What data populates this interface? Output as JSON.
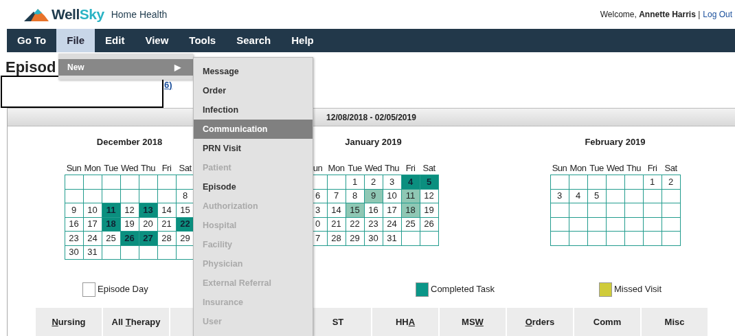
{
  "header": {
    "logo": {
      "dark_part": "Well",
      "accent_part": "Sky"
    },
    "product": "Home Health",
    "welcome": "Welcome, **Annette Harris** |",
    "logout": "Log Out"
  },
  "menu_bar": [
    {
      "label": "Go To",
      "selected": false
    },
    {
      "label": "File",
      "selected": true
    },
    {
      "label": "Edit",
      "selected": false
    },
    {
      "label": "View",
      "selected": false
    },
    {
      "label": "Tools",
      "selected": false
    },
    {
      "label": "Search",
      "selected": false
    },
    {
      "label": "Help",
      "selected": false
    }
  ],
  "file_menu": [
    {
      "label": "New",
      "arrow": "▶",
      "selected": true
    }
  ],
  "new_submenu": [
    {
      "label": "Message",
      "selected": false,
      "disabled": false
    },
    {
      "label": "Order",
      "selected": false,
      "disabled": false
    },
    {
      "label": "Infection",
      "selected": false,
      "disabled": false
    },
    {
      "label": "Communication",
      "selected": true,
      "disabled": false
    },
    {
      "label": "PRN Visit",
      "selected": false,
      "disabled": false
    },
    {
      "label": "Patient",
      "selected": false,
      "disabled": true
    },
    {
      "label": "Episode",
      "selected": false,
      "disabled": false
    },
    {
      "label": "Authorization",
      "selected": false,
      "disabled": true
    },
    {
      "label": "Hospital",
      "selected": false,
      "disabled": true
    },
    {
      "label": "Facility",
      "selected": false,
      "disabled": true
    },
    {
      "label": "Physician",
      "selected": false,
      "disabled": true
    },
    {
      "label": "External Referral",
      "selected": false,
      "disabled": true
    },
    {
      "label": "Insurance",
      "selected": false,
      "disabled": true
    },
    {
      "label": "User",
      "selected": false,
      "disabled": true
    }
  ],
  "page_title": "Episod",
  "link_fragment": "6)",
  "panel": {
    "date_range": "12/08/2018 - 02/05/2019",
    "calendars": [
      {
        "title": "December 2018",
        "weekdays": [
          "Sun",
          "Mon",
          "Tue",
          "Wed",
          "Thu",
          "Fri",
          "Sat"
        ],
        "weeks": [
          [
            {
              "kind": "blank"
            },
            {
              "kind": "blank"
            },
            {
              "kind": "blank"
            },
            {
              "kind": "blank"
            },
            {
              "kind": "blank"
            },
            {
              "kind": "blank"
            },
            {
              "kind": "blank"
            }
          ],
          [
            {
              "kind": "blank"
            },
            {
              "kind": "blank"
            },
            {
              "kind": "blank"
            },
            {
              "kind": "blank"
            },
            {
              "kind": "blank"
            },
            {
              "kind": "blank"
            },
            {
              "kind": "day",
              "day": "8",
              "completed": false,
              "highlighted": false
            }
          ],
          [
            {
              "kind": "day",
              "day": "9",
              "completed": false,
              "highlighted": false
            },
            {
              "kind": "day",
              "day": "10",
              "completed": false,
              "highlighted": false
            },
            {
              "kind": "day",
              "day": "11",
              "completed": true,
              "highlighted": false
            },
            {
              "kind": "day",
              "day": "12",
              "completed": false,
              "highlighted": false
            },
            {
              "kind": "day",
              "day": "13",
              "completed": true,
              "highlighted": false
            },
            {
              "kind": "day",
              "day": "14",
              "completed": false,
              "highlighted": false
            },
            {
              "kind": "day",
              "day": "15",
              "completed": false,
              "highlighted": false
            }
          ],
          [
            {
              "kind": "day",
              "day": "16",
              "completed": false,
              "highlighted": false
            },
            {
              "kind": "day",
              "day": "17",
              "completed": false,
              "highlighted": false
            },
            {
              "kind": "day",
              "day": "18",
              "completed": true,
              "highlighted": false
            },
            {
              "kind": "day",
              "day": "19",
              "completed": false,
              "highlighted": false
            },
            {
              "kind": "day",
              "day": "20",
              "completed": false,
              "highlighted": false
            },
            {
              "kind": "day",
              "day": "21",
              "completed": false,
              "highlighted": false
            },
            {
              "kind": "day",
              "day": "22",
              "completed": true,
              "highlighted": false
            }
          ],
          [
            {
              "kind": "day",
              "day": "23",
              "completed": false,
              "highlighted": false
            },
            {
              "kind": "day",
              "day": "24",
              "completed": false,
              "highlighted": false
            },
            {
              "kind": "day",
              "day": "25",
              "completed": false,
              "highlighted": false
            },
            {
              "kind": "day",
              "day": "26",
              "completed": true,
              "highlighted": false
            },
            {
              "kind": "day",
              "day": "27",
              "completed": true,
              "highlighted": false
            },
            {
              "kind": "day",
              "day": "28",
              "completed": false,
              "highlighted": false
            },
            {
              "kind": "day",
              "day": "29",
              "completed": false,
              "highlighted": false
            }
          ],
          [
            {
              "kind": "day",
              "day": "30",
              "completed": false,
              "highlighted": false
            },
            {
              "kind": "day",
              "day": "31",
              "completed": false,
              "highlighted": false
            },
            {
              "kind": "blank"
            },
            {
              "kind": "blank"
            },
            {
              "kind": "blank"
            },
            {
              "kind": "blank"
            },
            {
              "kind": "blank"
            }
          ]
        ]
      },
      {
        "title": "January 2019",
        "weekdays": [
          "un",
          "Mon",
          "Tue",
          "Wed",
          "Thu",
          "Fri",
          "Sat"
        ],
        "weeks": [
          [
            {
              "kind": "blank"
            },
            {
              "kind": "blank"
            },
            {
              "kind": "day",
              "day": "1",
              "completed": false,
              "highlighted": false
            },
            {
              "kind": "day",
              "day": "2",
              "completed": false,
              "highlighted": false
            },
            {
              "kind": "day",
              "day": "3",
              "completed": false,
              "highlighted": false
            },
            {
              "kind": "day",
              "day": "4",
              "completed": true,
              "highlighted": false
            },
            {
              "kind": "day",
              "day": "5",
              "completed": true,
              "highlighted": false
            }
          ],
          [
            {
              "kind": "day",
              "day": "6",
              "completed": false,
              "highlighted": false
            },
            {
              "kind": "day",
              "day": "7",
              "completed": false,
              "highlighted": false
            },
            {
              "kind": "day",
              "day": "8",
              "completed": false,
              "highlighted": false
            },
            {
              "kind": "day",
              "day": "9",
              "completed": false,
              "highlighted": true
            },
            {
              "kind": "day",
              "day": "10",
              "completed": false,
              "highlighted": false
            },
            {
              "kind": "day",
              "day": "11",
              "completed": false,
              "highlighted": true
            },
            {
              "kind": "day",
              "day": "12",
              "completed": false,
              "highlighted": false
            }
          ],
          [
            {
              "kind": "day",
              "day": "3",
              "completed": false,
              "highlighted": false
            },
            {
              "kind": "day",
              "day": "14",
              "completed": false,
              "highlighted": false
            },
            {
              "kind": "day",
              "day": "15",
              "completed": false,
              "highlighted": true
            },
            {
              "kind": "day",
              "day": "16",
              "completed": false,
              "highlighted": false
            },
            {
              "kind": "day",
              "day": "17",
              "completed": false,
              "highlighted": false
            },
            {
              "kind": "day",
              "day": "18",
              "completed": false,
              "highlighted": true
            },
            {
              "kind": "day",
              "day": "19",
              "completed": false,
              "highlighted": false
            }
          ],
          [
            {
              "kind": "day",
              "day": "0",
              "completed": false,
              "highlighted": false
            },
            {
              "kind": "day",
              "day": "21",
              "completed": false,
              "highlighted": false
            },
            {
              "kind": "day",
              "day": "22",
              "completed": false,
              "highlighted": false
            },
            {
              "kind": "day",
              "day": "23",
              "completed": false,
              "highlighted": false
            },
            {
              "kind": "day",
              "day": "24",
              "completed": false,
              "highlighted": false
            },
            {
              "kind": "day",
              "day": "25",
              "completed": false,
              "highlighted": false
            },
            {
              "kind": "day",
              "day": "26",
              "completed": false,
              "highlighted": false
            }
          ],
          [
            {
              "kind": "day",
              "day": "7",
              "completed": false,
              "highlighted": false
            },
            {
              "kind": "day",
              "day": "28",
              "completed": false,
              "highlighted": false
            },
            {
              "kind": "day",
              "day": "29",
              "completed": false,
              "highlighted": false
            },
            {
              "kind": "day",
              "day": "30",
              "completed": false,
              "highlighted": false
            },
            {
              "kind": "day",
              "day": "31",
              "completed": false,
              "highlighted": false
            },
            {
              "kind": "blank"
            },
            {
              "kind": "blank"
            }
          ]
        ]
      },
      {
        "title": "February 2019",
        "weekdays": [
          "Sun",
          "Mon",
          "Tue",
          "Wed",
          "Thu",
          "Fri",
          "Sat"
        ],
        "weeks": [
          [
            {
              "kind": "blank"
            },
            {
              "kind": "blank"
            },
            {
              "kind": "blank"
            },
            {
              "kind": "blank"
            },
            {
              "kind": "blank"
            },
            {
              "kind": "day",
              "day": "1",
              "completed": false,
              "highlighted": false
            },
            {
              "kind": "day",
              "day": "2",
              "completed": false,
              "highlighted": false
            }
          ],
          [
            {
              "kind": "day",
              "day": "3",
              "completed": false,
              "highlighted": false
            },
            {
              "kind": "day",
              "day": "4",
              "completed": false,
              "highlighted": false
            },
            {
              "kind": "day",
              "day": "5",
              "completed": false,
              "highlighted": false
            },
            {
              "kind": "blank"
            },
            {
              "kind": "blank"
            },
            {
              "kind": "blank"
            },
            {
              "kind": "blank"
            }
          ],
          [
            {
              "kind": "blank"
            },
            {
              "kind": "blank"
            },
            {
              "kind": "blank"
            },
            {
              "kind": "blank"
            },
            {
              "kind": "blank"
            },
            {
              "kind": "blank"
            },
            {
              "kind": "blank"
            }
          ],
          [
            {
              "kind": "blank"
            },
            {
              "kind": "blank"
            },
            {
              "kind": "blank"
            },
            {
              "kind": "blank"
            },
            {
              "kind": "blank"
            },
            {
              "kind": "blank"
            },
            {
              "kind": "blank"
            }
          ],
          [
            {
              "kind": "blank"
            },
            {
              "kind": "blank"
            },
            {
              "kind": "blank"
            },
            {
              "kind": "blank"
            },
            {
              "kind": "blank"
            },
            {
              "kind": "blank"
            },
            {
              "kind": "blank"
            }
          ]
        ]
      }
    ],
    "legend": [
      {
        "label": "Episode Day",
        "color": "#ffffff"
      },
      {
        "label": "Completed Task",
        "color": "#0b9688"
      },
      {
        "label": "Missed Visit",
        "color": "#cfcb3a"
      }
    ],
    "tabs": [
      {
        "kind": "label",
        "parts": [
          {
            "text": "N",
            "underlined": true
          },
          {
            "text": "ursing",
            "underlined": false
          }
        ]
      },
      {
        "kind": "label",
        "parts": [
          {
            "text": "All ",
            "underlined": false
          },
          {
            "text": "T",
            "underlined": true
          },
          {
            "text": "herapy",
            "underlined": false
          }
        ]
      },
      {
        "kind": "covered"
      },
      {
        "kind": "label",
        "parts": [
          {
            "text": "ST",
            "underlined": false
          }
        ]
      },
      {
        "kind": "label",
        "parts": [
          {
            "text": "HH",
            "underlined": false
          },
          {
            "text": "A",
            "underlined": true
          }
        ]
      },
      {
        "kind": "label",
        "parts": [
          {
            "text": "MS",
            "underlined": false
          },
          {
            "text": "W",
            "underlined": true
          }
        ]
      },
      {
        "kind": "label",
        "parts": [
          {
            "text": "O",
            "underlined": true
          },
          {
            "text": "rders",
            "underlined": false
          }
        ]
      },
      {
        "kind": "label",
        "parts": [
          {
            "text": "Comm",
            "underlined": false
          }
        ]
      },
      {
        "kind": "label",
        "parts": [
          {
            "text": "Misc",
            "underlined": false
          }
        ]
      }
    ]
  }
}
